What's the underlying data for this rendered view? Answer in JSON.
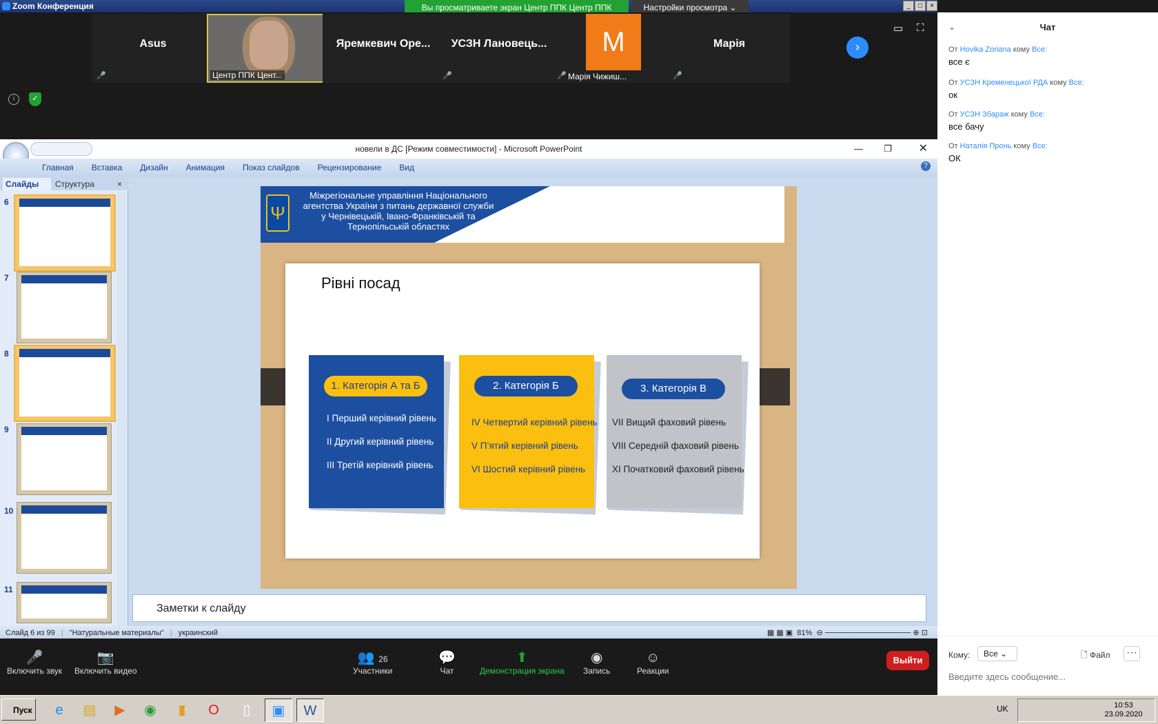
{
  "zoom": {
    "window_title": "Zoom Конференция",
    "banner": "Вы просматриваете экран Центр ППК Центр ППК",
    "view_options": "Настройки просмотра",
    "participants": [
      {
        "name": "Asus"
      },
      {
        "name": "Центр ППК Цент..."
      },
      {
        "name": "Яремкевич  Оре..."
      },
      {
        "name": "УСЗН  Лановець..."
      },
      {
        "name": "Марія Чижиш...",
        "avatar_letter": "M"
      },
      {
        "name": "Марія"
      }
    ],
    "controls": {
      "mute": "Включить звук",
      "video": "Включить видео",
      "participants": "Участники",
      "participants_count": "26",
      "chat": "Чат",
      "share": "Демонстрация экрана",
      "record": "Запись",
      "reactions": "Реакции",
      "leave": "Выйти"
    }
  },
  "ppt": {
    "title": "новели в ДС [Режим совместимости] - Microsoft PowerPoint",
    "tabs": [
      "Главная",
      "Вставка",
      "Дизайн",
      "Анимация",
      "Показ слайдов",
      "Рецензирование",
      "Вид"
    ],
    "side_tabs": {
      "slides": "Слайды",
      "outline": "Структура"
    },
    "thumb_numbers": [
      "6",
      "7",
      "8",
      "9",
      "10",
      "11"
    ],
    "notes_placeholder": "Заметки к слайду",
    "status": {
      "slide": "Слайд 6 из 99",
      "theme": "\"Натуральные материалы\"",
      "language": "украинский",
      "zoom": "81%"
    },
    "slide": {
      "header": "Міжрегіональне управління Національного агентства України з питань державної служби  у Чернівецькій, Івано-Франківській та Тернопільській областях",
      "title": "Рівні посад",
      "cards": [
        {
          "label": "1.    Категорія А та Б",
          "items": [
            "І Перший керівний рівень",
            "ІІ Другий керівний рівень",
            "ІІІ Третій керівний рівень"
          ]
        },
        {
          "label": "2. Категорія Б",
          "items": [
            "IV Четвертий керівний рівень",
            "V П’ятий керівний рівень",
            "VI Шостий керівний рівень"
          ]
        },
        {
          "label": "3. Категорія В",
          "items": [
            "VII Вищий фаховий рівень",
            "VIII Середній фаховий рівень",
            "ХІ Початковий фаховий рівень"
          ]
        }
      ]
    }
  },
  "chat": {
    "title": "Чат",
    "from_prefix": "От",
    "to_word": "кому",
    "everyone": "Все:",
    "messages": [
      {
        "from": "Hovika Zoriana",
        "text": "все є"
      },
      {
        "from": "УСЗН Кременецької РДА",
        "text": "ок"
      },
      {
        "from": "УСЗН Збараж",
        "text": "все бачу"
      },
      {
        "from": "Наталія Пронь",
        "text": "ОК"
      }
    ],
    "to_label": "Кому:",
    "to_value": "Все",
    "file_label": "Файл",
    "input_placeholder": "Введите здесь сообщение..."
  },
  "taskbar": {
    "start": "Пуск",
    "lang": "UK",
    "time": "10:53",
    "date": "23.09.2020"
  },
  "colors": {
    "slide_blue": "#1d4fa0",
    "card_yellow": "#fbbf10",
    "card_gray": "#c2c3c8",
    "share_green": "#23a233",
    "exit_red": "#cf1e1e",
    "avatar_orange": "#f07b18"
  }
}
